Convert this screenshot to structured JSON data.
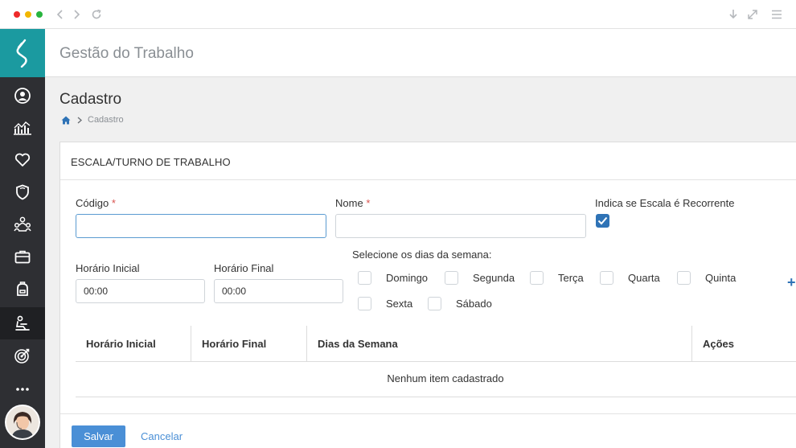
{
  "app": {
    "title": "Gestão do Trabalho"
  },
  "page": {
    "title": "Cadastro",
    "breadcrumb": {
      "current": "Cadastro"
    }
  },
  "form": {
    "section_title": "ESCALA/TURNO DE TRABALHO",
    "codigo": {
      "label": "Código",
      "required_mark": "*",
      "value": ""
    },
    "nome": {
      "label": "Nome",
      "required_mark": "*",
      "value": ""
    },
    "recorrente": {
      "label": "Indica se Escala é Recorrente",
      "checked": true
    },
    "horario_inicial": {
      "label": "Horário Inicial",
      "value": "00:00"
    },
    "horario_final": {
      "label": "Horário Final",
      "value": "00:00"
    },
    "dias": {
      "label": "Selecione os dias da semana:",
      "items": [
        {
          "label": "Domingo",
          "checked": false
        },
        {
          "label": "Segunda",
          "checked": false
        },
        {
          "label": "Terça",
          "checked": false
        },
        {
          "label": "Quarta",
          "checked": false
        },
        {
          "label": "Quinta",
          "checked": false
        },
        {
          "label": "Sexta",
          "checked": false
        },
        {
          "label": "Sábado",
          "checked": false
        }
      ],
      "add_symbol": "+"
    }
  },
  "table": {
    "columns": [
      "Horário Inicial",
      "Horário Final",
      "Dias da Semana",
      "Ações"
    ],
    "empty_message": "Nenhum item cadastrado"
  },
  "actions": {
    "save_label": "Salvar",
    "cancel_label": "Cancelar"
  },
  "colors": {
    "accent": "#1b9aa0",
    "primary": "#4a8fd6",
    "checkbox": "#2f73b6",
    "sidebar": "#2e2f33"
  },
  "icons": {
    "sidebar": [
      "user-circle-icon",
      "chart-icon",
      "heart-icon",
      "shield-icon",
      "people-network-icon",
      "briefcase-icon",
      "backpack-icon",
      "workstation-icon",
      "target-icon",
      "more-icon"
    ]
  }
}
